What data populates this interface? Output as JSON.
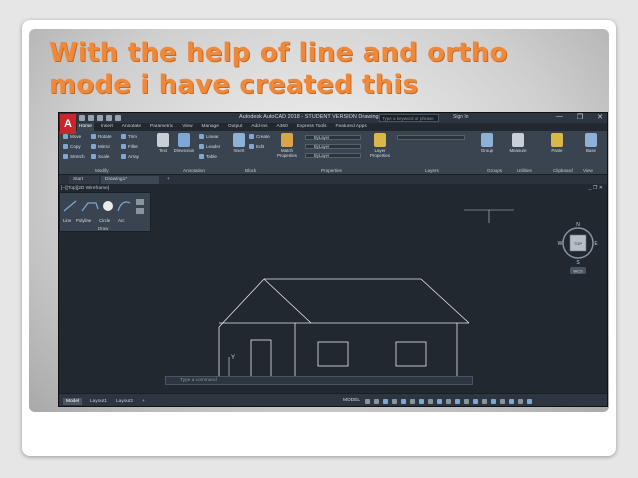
{
  "slide": {
    "title_line1": "With the help of  line and ortho",
    "title_line2": "mode i have created this"
  },
  "app": {
    "logo_letter": "A",
    "window_title": "Autodesk AutoCAD 2018 - STUDENT VERSION   Drawing1.dwg",
    "search_placeholder": "Type a keyword or phrase",
    "sign_in": "Sign In",
    "ribbon_tabs": [
      "Home",
      "Insert",
      "Annotate",
      "Parametric",
      "View",
      "Manage",
      "Output",
      "Add-ins",
      "A360",
      "Express Tools",
      "Featured Apps"
    ],
    "active_tab": "Home",
    "modify_tools": [
      "Move",
      "Rotate",
      "Trim",
      "Copy",
      "Mirror",
      "Fillet",
      "Stretch",
      "Scale",
      "Array"
    ],
    "annotation_tools": [
      "Text",
      "Dimension",
      "Linear",
      "Leader",
      "Table"
    ],
    "block_tools": [
      "Insert",
      "Create",
      "Edit"
    ],
    "properties_tools": [
      "Match Properties",
      "ByLayer",
      "ByLayer",
      "ByLayer"
    ],
    "layer_tools": [
      "Layer Properties"
    ],
    "other_tools": [
      "Group",
      "Measure",
      "Paste",
      "Base"
    ],
    "group_labels": [
      "Modify",
      "Annotation",
      "Block",
      "Properties",
      "Layers",
      "Groups",
      "Utilities",
      "Clipboard",
      "View"
    ],
    "file_tabs": [
      "Start",
      "Drawing1*"
    ],
    "file_tab_plus": "+",
    "viewport_label": "[−][Top][2D Wireframe]",
    "draw_tools": [
      "Line",
      "Polyline",
      "Circle",
      "Arc"
    ],
    "draw_label": "Draw",
    "command_placeholder": "Type a command",
    "layout_tabs": [
      "Model",
      "Layout1",
      "Layout2"
    ],
    "layout_plus": "+",
    "status_model": "MODEL",
    "window_controls": [
      "—",
      "❐",
      "✕"
    ],
    "drawing_window_controls": "_ ❐ ✕",
    "viewcube": {
      "top": "TOP",
      "n": "N",
      "s": "S",
      "e": "E",
      "w": "W",
      "wcs": "WCS"
    },
    "ucs": {
      "x": "X",
      "y": "Y"
    }
  }
}
